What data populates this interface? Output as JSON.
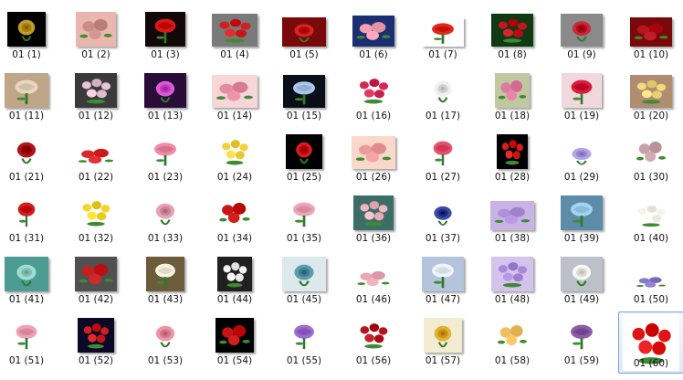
{
  "folder": {
    "selected_index": 59,
    "items": [
      {
        "label": "01 (1)",
        "bg": "#000000",
        "fg": "#c49a2c",
        "icon": "harp-angel-icon",
        "framed": true
      },
      {
        "label": "01 (2)",
        "bg": "#e9b7ae",
        "fg": "#c98c86",
        "icon": "baby-cherub-icon",
        "framed": true
      },
      {
        "label": "01 (3)",
        "bg": "#120808",
        "fg": "#d71a1a",
        "icon": "glass-box-rose-icon",
        "framed": true
      },
      {
        "label": "01 (4)",
        "bg": "#7a7a7a",
        "fg": "#d21e1e",
        "icon": "single-rose-icon",
        "framed": true
      },
      {
        "label": "01 (5)",
        "bg": "#7a0a0a",
        "fg": "#d42525",
        "icon": "red-rose-icon",
        "framed": true
      },
      {
        "label": "01 (6)",
        "bg": "#1c2e72",
        "fg": "#f4a0b4",
        "icon": "pink-rose-icon",
        "framed": true
      },
      {
        "label": "01 (7)",
        "bg": "#ffffff",
        "fg": "#e0281e",
        "icon": "strawberries-icon",
        "framed": true
      },
      {
        "label": "01 (8)",
        "bg": "#0f3a12",
        "fg": "#c8141e",
        "icon": "red-roses-icon",
        "framed": true
      },
      {
        "label": "01 (9)",
        "bg": "#8a8a8a",
        "fg": "#c8283a",
        "icon": "rose-bouquet-icon",
        "framed": true
      },
      {
        "label": "01 (10)",
        "bg": "#7a0a0a",
        "fg": "#b8141e",
        "icon": "red-roses-icon",
        "framed": true
      },
      {
        "label": "01 (11)",
        "bg": "#bfa688",
        "fg": "#ead7c0",
        "icon": "cream-rose-icon",
        "framed": true
      },
      {
        "label": "01 (12)",
        "bg": "#3a3a3a",
        "fg": "#e8c4d4",
        "icon": "white-rose-icon",
        "framed": true
      },
      {
        "label": "01 (13)",
        "bg": "#2a0c38",
        "fg": "#dc5ad8",
        "icon": "tulips-icon",
        "framed": true
      },
      {
        "label": "01 (14)",
        "bg": "#f6d6d6",
        "fg": "#e68aa0",
        "icon": "flower-basket-icon",
        "framed": true
      },
      {
        "label": "01 (15)",
        "bg": "#0a0e18",
        "fg": "#a8c8f0",
        "icon": "blue-flower-icon",
        "framed": true
      },
      {
        "label": "01 (16)",
        "bg": "#ffffff",
        "fg": "#d42855",
        "icon": "rose-card-icon",
        "framed": false
      },
      {
        "label": "01 (17)",
        "bg": "#ffffff",
        "fg": "#f0f0f0",
        "icon": "white-lilies-icon",
        "framed": false
      },
      {
        "label": "01 (18)",
        "bg": "#c0c8a0",
        "fg": "#e07aa0",
        "icon": "pink-lily-icon",
        "framed": true
      },
      {
        "label": "01 (19)",
        "bg": "#f0d8dc",
        "fg": "#d81e3c",
        "icon": "red-lily-icon",
        "framed": true
      },
      {
        "label": "01 (20)",
        "bg": "#b08c70",
        "fg": "#f0dc7c",
        "icon": "yellow-flowers-icon",
        "framed": true
      },
      {
        "label": "01 (21)",
        "bg": "#ffffff",
        "fg": "#b0141e",
        "icon": "red-roses-icon",
        "framed": false
      },
      {
        "label": "01 (22)",
        "bg": "#ffffff",
        "fg": "#d82828",
        "icon": "rose-petals-icon",
        "framed": false
      },
      {
        "label": "01 (23)",
        "bg": "#ffffff",
        "fg": "#f08ca8",
        "icon": "pink-hat-icon",
        "framed": false
      },
      {
        "label": "01 (24)",
        "bg": "#ffffff",
        "fg": "#f4d23c",
        "icon": "yellow-rose-icon",
        "framed": false
      },
      {
        "label": "01 (25)",
        "bg": "#000000",
        "fg": "#d21e1e",
        "icon": "red-tulip-icon",
        "framed": true
      },
      {
        "label": "01 (26)",
        "bg": "#f8d8c8",
        "fg": "#ec9a9a",
        "icon": "pink-bouquet-icon",
        "framed": true
      },
      {
        "label": "01 (27)",
        "bg": "#ffffff",
        "fg": "#e8506e",
        "icon": "pink-rose-icon",
        "framed": false
      },
      {
        "label": "01 (28)",
        "bg": "#000000",
        "fg": "#d41e1e",
        "icon": "red-rose-stem-icon",
        "framed": true
      },
      {
        "label": "01 (29)",
        "bg": "#ffffff",
        "fg": "#b4a4ec",
        "icon": "purple-flowers-icon",
        "framed": false
      },
      {
        "label": "01 (30)",
        "bg": "#ffffff",
        "fg": "#c8a0a8",
        "icon": "rose-bunch-icon",
        "framed": false
      },
      {
        "label": "01 (31)",
        "bg": "#ffffff",
        "fg": "#d21e1e",
        "icon": "single-rose-icon",
        "framed": false
      },
      {
        "label": "01 (32)",
        "bg": "#ffffff",
        "fg": "#f4d428",
        "icon": "yellow-roses-icon",
        "framed": false
      },
      {
        "label": "01 (33)",
        "bg": "#ffffff",
        "fg": "#e8a0b4",
        "icon": "flower-vase-icon",
        "framed": false
      },
      {
        "label": "01 (34)",
        "bg": "#ffffff",
        "fg": "#c81414",
        "icon": "red-rose-basket-icon",
        "framed": false
      },
      {
        "label": "01 (35)",
        "bg": "#ffffff",
        "fg": "#f0a4b8",
        "icon": "pink-roses-icon",
        "framed": false
      },
      {
        "label": "01 (36)",
        "bg": "#3c6e68",
        "fg": "#f4b4c0",
        "icon": "pink-rose-icon",
        "framed": true
      },
      {
        "label": "01 (37)",
        "bg": "#ffffff",
        "fg": "#3c4ca0",
        "icon": "mixed-flowers-icon",
        "framed": false
      },
      {
        "label": "01 (38)",
        "bg": "#c8b4e4",
        "fg": "#b090d8",
        "icon": "lilac-flowers-icon",
        "framed": true
      },
      {
        "label": "01 (39)",
        "bg": "#5c8ca8",
        "fg": "#a4d4f0",
        "icon": "blue-flowers-icon",
        "framed": true
      },
      {
        "label": "01 (40)",
        "bg": "#ffffff",
        "fg": "#f4f4e8",
        "icon": "white-flowers-icon",
        "framed": false
      },
      {
        "label": "01 (41)",
        "bg": "#4c9c94",
        "fg": "#a0dcd0",
        "icon": "teal-flowers-icon",
        "framed": true
      },
      {
        "label": "01 (42)",
        "bg": "#505050",
        "fg": "#c81e1e",
        "icon": "red-roses-icon",
        "framed": true
      },
      {
        "label": "01 (43)",
        "bg": "#6c5c3c",
        "fg": "#f8f4e0",
        "icon": "daisies-icon",
        "framed": true
      },
      {
        "label": "01 (44)",
        "bg": "#202020",
        "fg": "#f4f4f4",
        "icon": "white-roses-icon",
        "framed": true
      },
      {
        "label": "01 (45)",
        "bg": "#dce8ec",
        "fg": "#5c9cb0",
        "icon": "teal-ornament-icon",
        "framed": true
      },
      {
        "label": "01 (46)",
        "bg": "#ffffff",
        "fg": "#e8a8b4",
        "icon": "flower-spray-icon",
        "framed": false
      },
      {
        "label": "01 (47)",
        "bg": "#b4c4dc",
        "fg": "#f0f4fc",
        "icon": "angel-icon",
        "framed": true
      },
      {
        "label": "01 (48)",
        "bg": "#d4c4ec",
        "fg": "#a888d8",
        "icon": "lavender-rose-icon",
        "framed": true
      },
      {
        "label": "01 (49)",
        "bg": "#bcc0c8",
        "fg": "#f8f8f0",
        "icon": "white-flowers-icon",
        "framed": true
      },
      {
        "label": "01 (50)",
        "bg": "#ffffff",
        "fg": "#8878c8",
        "icon": "flower-sprig-icon",
        "framed": false
      },
      {
        "label": "01 (51)",
        "bg": "#ffffff",
        "fg": "#f0a0b4",
        "icon": "pink-flower-basket-icon",
        "framed": false
      },
      {
        "label": "01 (52)",
        "bg": "#0a0a28",
        "fg": "#d21e1e",
        "icon": "rose-vase-icon",
        "framed": true
      },
      {
        "label": "01 (53)",
        "bg": "#ffffff",
        "fg": "#f094a8",
        "icon": "pink-lilies-icon",
        "framed": false
      },
      {
        "label": "01 (54)",
        "bg": "#000000",
        "fg": "#c81414",
        "icon": "red-roses-icon",
        "framed": true
      },
      {
        "label": "01 (55)",
        "bg": "#ffffff",
        "fg": "#9c6cd0",
        "icon": "purple-vase-icon",
        "framed": false
      },
      {
        "label": "01 (56)",
        "bg": "#ffffff",
        "fg": "#b4141e",
        "icon": "red-rose-icon",
        "framed": false
      },
      {
        "label": "01 (57)",
        "bg": "#f4ecd0",
        "fg": "#e4b030",
        "icon": "framed-flowers-icon",
        "framed": true
      },
      {
        "label": "01 (58)",
        "bg": "#ffffff",
        "fg": "#f0c060",
        "icon": "hand-flower-icon",
        "framed": false
      },
      {
        "label": "01 (59)",
        "bg": "#ffffff",
        "fg": "#8c5ca8",
        "icon": "purple-pot-icon",
        "framed": false
      },
      {
        "label": "01 (60)",
        "bg": "#ffffff",
        "fg": "#e01414",
        "icon": "red-rose-icon",
        "framed": false
      }
    ]
  }
}
